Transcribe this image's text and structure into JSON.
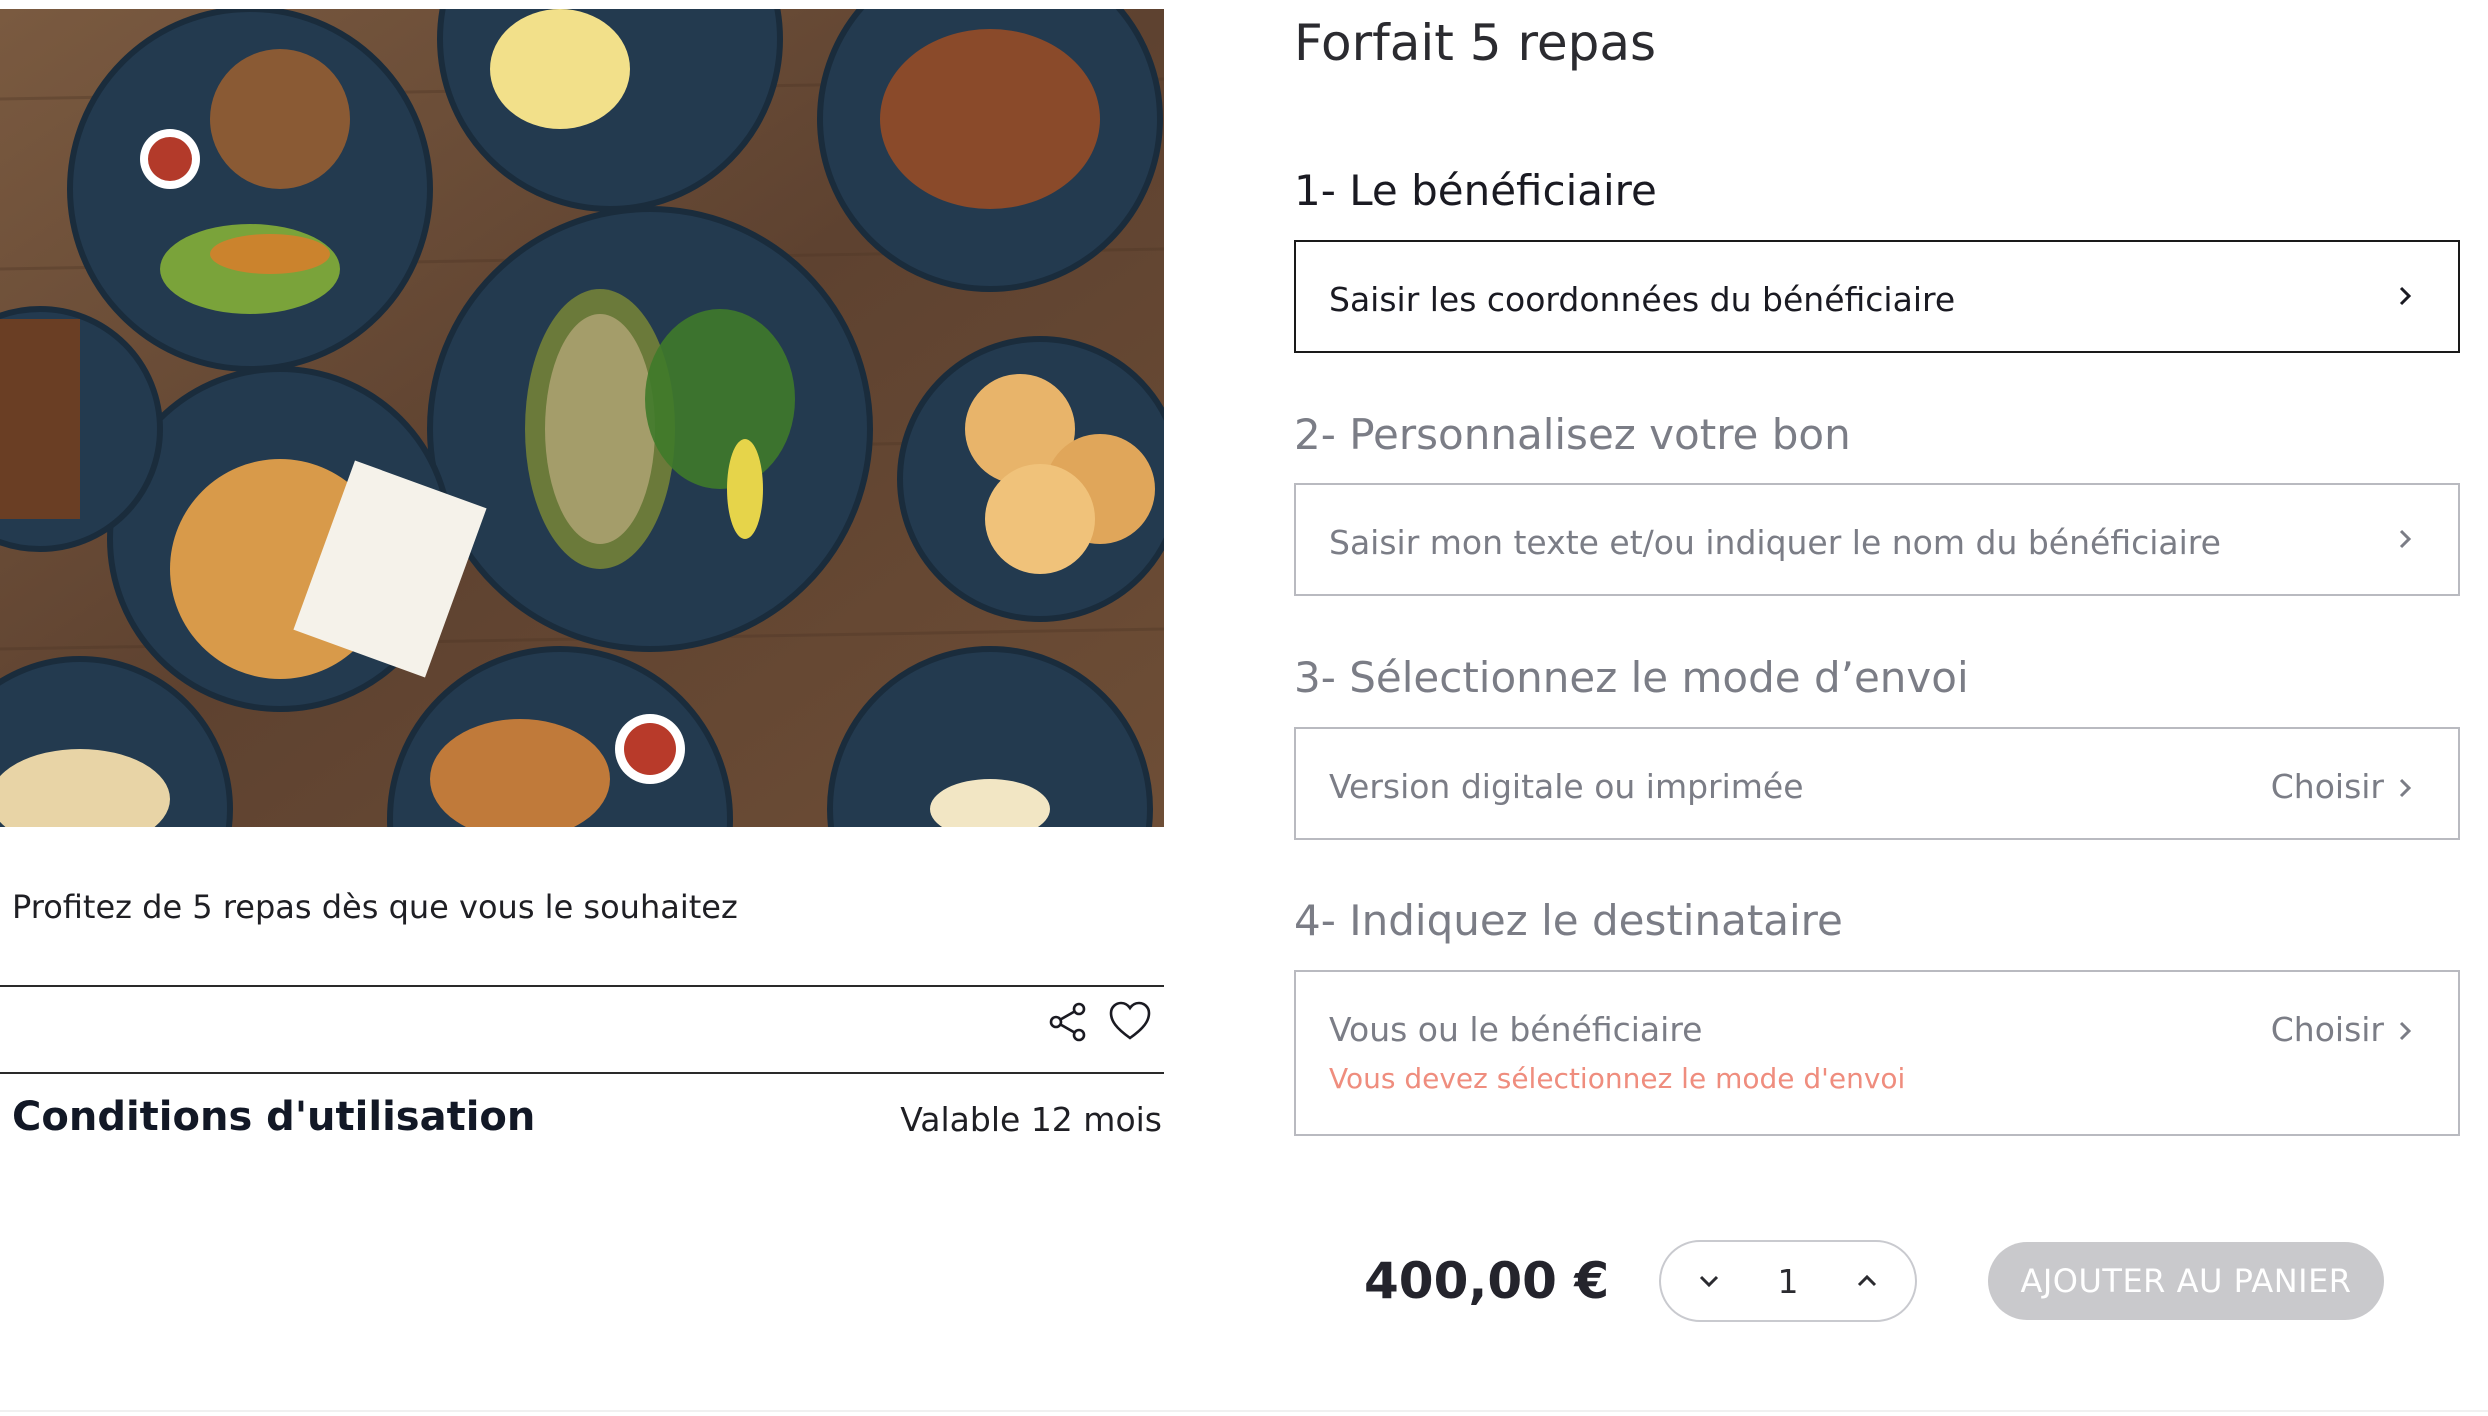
{
  "product": {
    "title": "Forfait 5 repas",
    "description": "Profitez de 5 repas dès que vous le souhaitez",
    "image_icon": "food-photo"
  },
  "actions": {
    "share_icon": "share-icon",
    "favorite_icon": "heart-icon"
  },
  "conditions": {
    "title": "Conditions d'utilisation",
    "validity": "Valable 12 mois"
  },
  "steps": [
    {
      "heading": "1- Le bénéficiaire",
      "field_text": "Saisir les coordonnées du bénéficiaire",
      "right_label": "",
      "error": ""
    },
    {
      "heading": "2- Personnalisez votre bon",
      "field_text": "Saisir mon texte et/ou indiquer le nom du bénéficiaire",
      "right_label": "",
      "error": ""
    },
    {
      "heading": "3- Sélectionnez le mode d’envoi",
      "field_text": "Version digitale ou imprimée",
      "right_label": "Choisir",
      "error": ""
    },
    {
      "heading": "4- Indiquez le destinataire",
      "field_text": "Vous ou le bénéficiaire",
      "right_label": "Choisir",
      "error": "Vous devez sélectionnez le mode d'envoi"
    }
  ],
  "purchase": {
    "price": "400,00 €",
    "quantity": "1",
    "add_to_cart_label": "AJOUTER AU PANIER"
  },
  "colors": {
    "active_border": "#1a1a1a",
    "inactive_border": "#b9bac0",
    "muted_text": "#7b7d86",
    "error_text": "#ef8d7e",
    "button_disabled": "#c9c9cc"
  }
}
